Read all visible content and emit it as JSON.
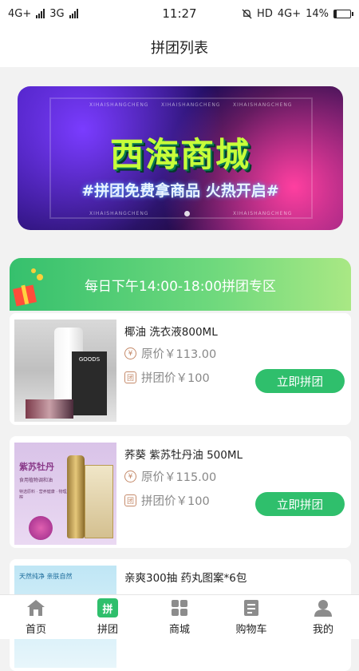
{
  "status": {
    "left_net1": "4G+",
    "left_net2": "3G",
    "time": "11:27",
    "right_net": "HD",
    "right_net2": "4G+",
    "battery": "14%",
    "battery_level": 0.14
  },
  "header": {
    "title": "拼团列表"
  },
  "banner": {
    "title": "西海商城",
    "subtitle": "#拼团免费拿商品 火热开启#",
    "brand_tag": "XIHAISHANGCHENG"
  },
  "zone": {
    "title": "每日下午14:00-18:00拼团专区"
  },
  "products": [
    {
      "name": "椰油 洗衣液800ML",
      "original_price": "原价￥113.00",
      "group_price": "拼团价￥100",
      "button": "立即拼团",
      "image_label": "GOODS"
    },
    {
      "name": "荞葵 紫苏牡丹油 500ML",
      "original_price": "原价￥115.00",
      "group_price": "拼团价￥100",
      "button": "立即拼团",
      "image_label": "紫苏牡丹",
      "image_sub": "食用植物调和油",
      "image_tags": "特选原料 · 营养健康 · 物理压榨"
    },
    {
      "name": "亲爽300抽 药丸图案*6包",
      "image_label": "天然纯净 亲肤自然"
    }
  ],
  "tabs": [
    {
      "label": "首页",
      "icon": "home-icon",
      "active": false
    },
    {
      "label": "拼团",
      "icon": "group-buy-icon",
      "active": true,
      "icon_text": "拼"
    },
    {
      "label": "商城",
      "icon": "mall-grid-icon",
      "active": false
    },
    {
      "label": "购物车",
      "icon": "cart-icon",
      "active": false
    },
    {
      "label": "我的",
      "icon": "user-icon",
      "active": false
    }
  ],
  "colors": {
    "accent": "#2fbf6c",
    "banner_title": "#c7ff3a",
    "price_icon": "#c58a6a"
  }
}
